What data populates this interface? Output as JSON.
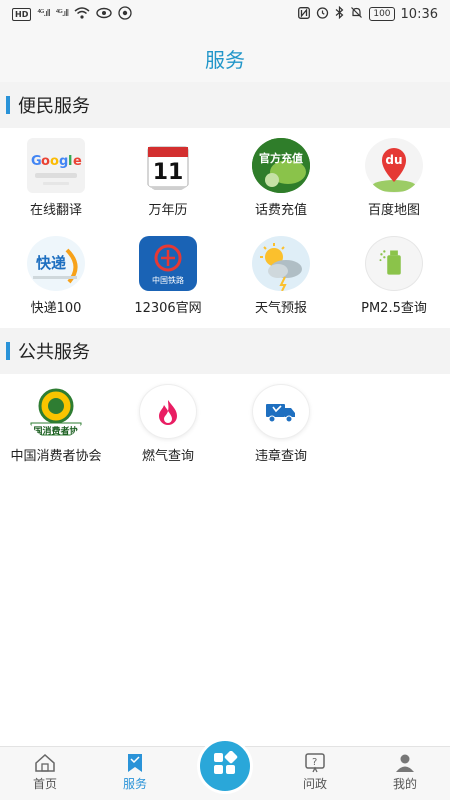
{
  "status_bar": {
    "hd_badge": "HD",
    "signal_1": "⁴ᴳ.ıll",
    "signal_2": "⁴ᴳ.ıll",
    "battery": "100",
    "time": "10:36"
  },
  "header": {
    "title": "服务"
  },
  "sections": [
    {
      "title": "便民服务",
      "items": [
        {
          "label": "在线翻译",
          "icon": "translate-icon"
        },
        {
          "label": "万年历",
          "icon": "calendar-icon"
        },
        {
          "label": "话费充值",
          "icon": "phone-recharge-icon"
        },
        {
          "label": "百度地图",
          "icon": "baidu-map-icon"
        },
        {
          "label": "快递100",
          "icon": "express-icon"
        },
        {
          "label": "12306官网",
          "icon": "railway-icon"
        },
        {
          "label": "天气预报",
          "icon": "weather-icon"
        },
        {
          "label": "PM2.5查询",
          "icon": "pm25-icon"
        }
      ]
    },
    {
      "title": "公共服务",
      "items": [
        {
          "label": "中国消费者协会",
          "icon": "consumer-association-icon"
        },
        {
          "label": "燃气查询",
          "icon": "gas-flame-icon"
        },
        {
          "label": "违章查询",
          "icon": "traffic-truck-icon"
        }
      ]
    }
  ],
  "icon_text": {
    "calendar_day": "11",
    "recharge_text": "官方充值",
    "baidu_text": "du",
    "express_text": "快递",
    "railway_text": "中国铁路",
    "consumer_text": "国消费者协"
  },
  "bottom_nav": {
    "items": [
      {
        "label": "首页",
        "icon": "home-icon"
      },
      {
        "label": "服务",
        "icon": "bookmark-icon"
      },
      {
        "label": "问政",
        "icon": "question-icon"
      },
      {
        "label": "我的",
        "icon": "person-icon"
      }
    ],
    "center_icon": "grid-apps-icon",
    "active_index": 1
  },
  "colors": {
    "accent": "#2a93d8",
    "title": "#2196c9",
    "center_button": "#2aa7d9"
  }
}
